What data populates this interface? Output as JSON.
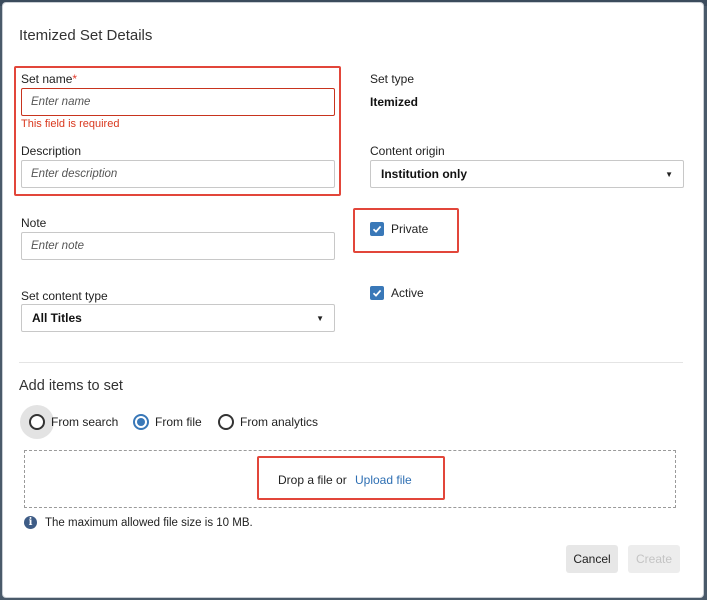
{
  "dialog": {
    "title": "Itemized Set Details"
  },
  "form": {
    "set_name": {
      "label": "Set name",
      "required_marker": "*",
      "placeholder": "Enter name",
      "value": "",
      "error": "This field is required"
    },
    "description": {
      "label": "Description",
      "placeholder": "Enter description",
      "value": ""
    },
    "note": {
      "label": "Note",
      "placeholder": "Enter note",
      "value": ""
    },
    "set_content_type": {
      "label": "Set content type",
      "value": "All Titles"
    },
    "set_type": {
      "label": "Set type",
      "value": "Itemized"
    },
    "content_origin": {
      "label": "Content origin",
      "value": "Institution only"
    },
    "private": {
      "label": "Private",
      "checked": true
    },
    "active": {
      "label": "Active",
      "checked": true
    }
  },
  "add_items": {
    "title": "Add items to set",
    "options": [
      {
        "label": "From search",
        "selected": false
      },
      {
        "label": "From file",
        "selected": true
      },
      {
        "label": "From analytics",
        "selected": false
      }
    ],
    "drop_text": "Drop a file or",
    "upload_link": "Upload file",
    "info_text": "The maximum allowed file size is 10 MB."
  },
  "footer": {
    "cancel_label": "Cancel",
    "create_label": "Create"
  },
  "colors": {
    "accent": "#3978b8",
    "error": "#d9381e",
    "highlight": "#e2463a",
    "link": "#2e6fb3"
  }
}
